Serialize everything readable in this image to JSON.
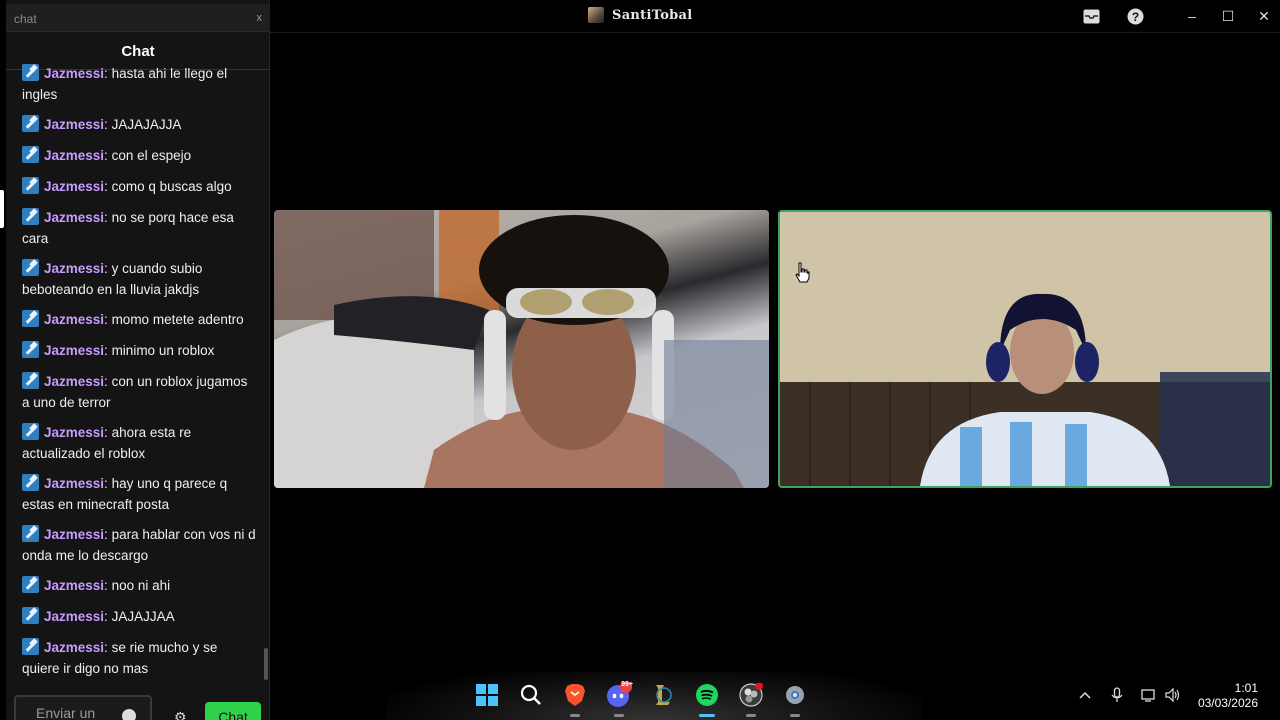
{
  "window": {
    "title": "SantiTobal",
    "buttons": {
      "minimize": "–",
      "maximize": "☐",
      "close": "✕"
    }
  },
  "chat": {
    "search_placeholder": "chat",
    "close_label": "x",
    "header": "Chat",
    "input_placeholder": "Enviar un",
    "send_label": "Chat",
    "messages": [
      {
        "user": "Jazmessi",
        "text": "hasta ahi le llego el ingles"
      },
      {
        "user": "Jazmessi",
        "text": "JAJAJAJJA"
      },
      {
        "user": "Jazmessi",
        "text": "con el espejo"
      },
      {
        "user": "Jazmessi",
        "text": "como q buscas algo"
      },
      {
        "user": "Jazmessi",
        "text": "no se porq hace esa cara"
      },
      {
        "user": "Jazmessi",
        "text": "y cuando subio beboteando en la lluvia jakdjs"
      },
      {
        "user": "Jazmessi",
        "text": "momo metete adentro"
      },
      {
        "user": "Jazmessi",
        "text": "minimo un roblox"
      },
      {
        "user": "Jazmessi",
        "text": "con un roblox jugamos a uno de terror"
      },
      {
        "user": "Jazmessi",
        "text": "ahora esta re actualizado el roblox"
      },
      {
        "user": "Jazmessi",
        "text": "hay uno q parece q estas en minecraft posta"
      },
      {
        "user": "Jazmessi",
        "text": "para hablar con vos ni d onda me lo descargo"
      },
      {
        "user": "Jazmessi",
        "text": "noo ni ahi"
      },
      {
        "user": "Jazmessi",
        "text": "JAJAJJAA"
      },
      {
        "user": "Jazmessi",
        "text": "se rie mucho y se quiere ir digo no mas"
      }
    ]
  },
  "videos": [
    {
      "name": "participant-left",
      "active_speaker": false
    },
    {
      "name": "participant-right",
      "active_speaker": true
    }
  ],
  "taskbar": {
    "apps": [
      "windows-start-icon",
      "search-icon",
      "brave-icon",
      "discord-icon",
      "league-of-legends-icon",
      "spotify-icon",
      "obs-icon",
      "settings-icon"
    ],
    "discord_badge": "99+",
    "time": "1:01",
    "date": "03/03/2026"
  },
  "colors": {
    "username": "#c79bff",
    "send_button": "#2fd14a",
    "active_speaker_border": "#3ea65a",
    "spotify": "#1ed760"
  }
}
